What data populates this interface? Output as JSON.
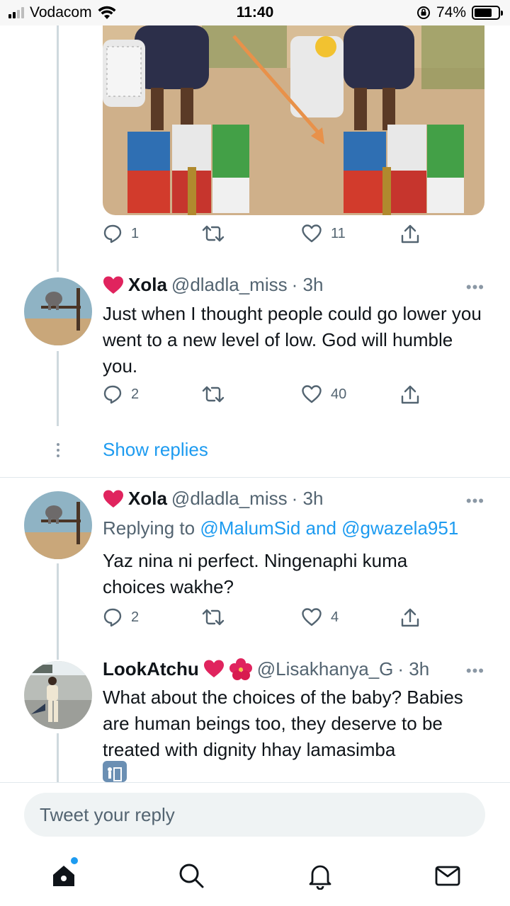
{
  "status_bar": {
    "carrier": "Vodacom",
    "time": "11:40",
    "battery_percent": "74%",
    "battery_level": 0.74
  },
  "media_tweet": {
    "stats": {
      "replies": "1",
      "retweets": "",
      "likes": "11"
    }
  },
  "tweets": [
    {
      "name": "Xola",
      "handle": "@dladla_miss",
      "time": "· 3h",
      "text": "Just when I thought people could go lower you went to a new level of low. God will humble you.",
      "stats": {
        "replies": "2",
        "retweets": "",
        "likes": "40"
      },
      "show_replies": "Show replies"
    },
    {
      "name": "Xola",
      "handle": "@dladla_miss",
      "time": "· 3h",
      "replying_to_prefix": "Replying to",
      "replying_to_mentions": "@MalumSid and @gwazela951",
      "text": "Yaz nina ni perfect. Ningenaphi kuma choices wakhe?",
      "stats": {
        "replies": "2",
        "retweets": "",
        "likes": "4"
      }
    },
    {
      "name": "LookAtchu",
      "handle": "@Lisakhanya_G",
      "time": "· 3h",
      "text": "What about the choices of the baby? Babies are human beings too, they deserve to be treated with dignity hhay lamasimba"
    }
  ],
  "reply_bar": {
    "placeholder": "Tweet your reply"
  },
  "icons": {
    "heart_emoji": "red-heart-emoji",
    "flower_emoji": "hibiscus-emoji",
    "trash_emoji": "wastebasket-emoji"
  },
  "colors": {
    "accent": "#1d9bf0",
    "secondary_text": "#536471"
  }
}
